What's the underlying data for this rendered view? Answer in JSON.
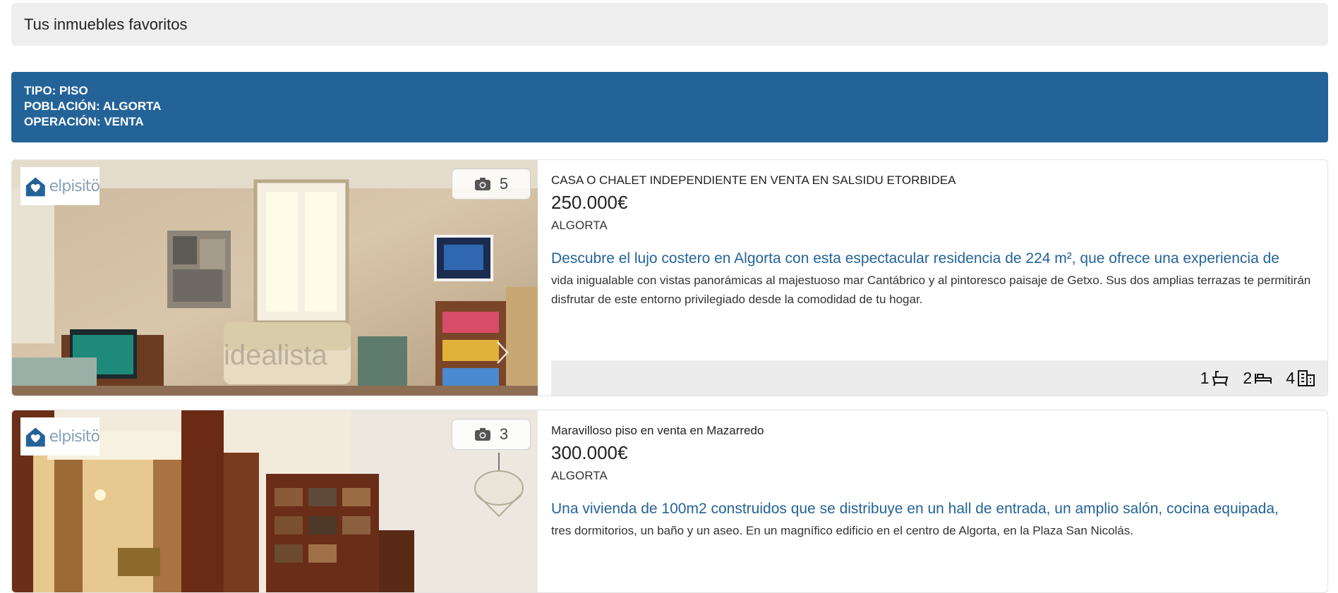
{
  "header": {
    "title": "Tus inmuebles favoritos"
  },
  "filters": {
    "tipo": "TIPO: PISO",
    "poblacion": "POBLACIÓN: ALGORTA",
    "operacion": "OPERACIÓN: VENTA"
  },
  "logo_text": "elpisitö",
  "listings": [
    {
      "photo_count": "5",
      "title": "CASA O CHALET INDEPENDIENTE EN VENTA EN SALSIDU ETORBIDEA",
      "price": "250.000€",
      "city": "ALGORTA",
      "lead": "Descubre el lujo costero en Algorta con esta espectacular residencia de 224 m², que ofrece una experiencia de",
      "description": "vida inigualable con vistas panorámicas al majestuoso mar Cantábrico y al pintoresco paisaje de Getxo. Sus dos amplias terrazas te permitirán disfrutar de este entorno privilegiado desde la comodidad de tu hogar.",
      "baths": "1",
      "rooms": "2",
      "floor": "4",
      "watermark": "idealista"
    },
    {
      "photo_count": "3",
      "title": "Maravilloso piso en venta en Mazarredo",
      "price": "300.000€",
      "city": "ALGORTA",
      "lead": "Una vivienda de 100m2 construidos que se distribuye en un hall de entrada, un amplio salón, cocina equipada,",
      "description": "tres dormitorios, un baño y un aseo. En un magnífico edificio en el centro de Algorta, en la Plaza San Nicolás."
    }
  ],
  "colors": {
    "brand_blue": "#246398",
    "panel_gray": "#eeeeef"
  },
  "icons": [
    "camera-icon",
    "house-heart-icon",
    "bathtub-icon",
    "bed-icon",
    "building-icon",
    "chevron-right-icon"
  ]
}
